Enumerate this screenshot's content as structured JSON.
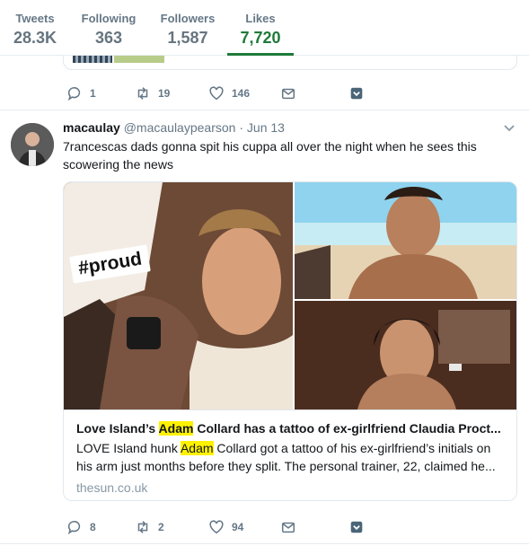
{
  "profile_nav": {
    "tweets": {
      "label": "Tweets",
      "value": "28.3K"
    },
    "following": {
      "label": "Following",
      "value": "363"
    },
    "followers": {
      "label": "Followers",
      "value": "1,587"
    },
    "likes": {
      "label": "Likes",
      "value": "7,720"
    },
    "active_color": "#1e7a3a"
  },
  "prev_tweet": {
    "replies": "1",
    "retweets": "19",
    "likes": "146"
  },
  "tweet": {
    "name": "macaulay",
    "handle": "@macaulaypearson",
    "separator": "·",
    "time": "Jun 13",
    "text": "7rancescas dads gonna spit his cuppa all over the night when he sees this scowering the news",
    "image_overlay_text": "#proud",
    "card": {
      "title_before": "Love Island’s ",
      "title_highlight": "Adam",
      "title_after": " Collard has a tattoo of ex-girlfriend Claudia Proct...",
      "desc_before": "LOVE Island hunk ",
      "desc_highlight": "Adam",
      "desc_after": " Collard got a tattoo of his ex-girlfriend’s initials on his arm just months before they split. The personal trainer, 22, claimed he...",
      "domain": "thesun.co.uk",
      "highlight_color": "#fff200"
    },
    "replies": "8",
    "retweets": "2",
    "likes": "94"
  },
  "icons": [
    "reply-icon",
    "retweet-icon",
    "heart-icon",
    "envelope-icon",
    "chevron-down-icon",
    "flag-icon"
  ]
}
